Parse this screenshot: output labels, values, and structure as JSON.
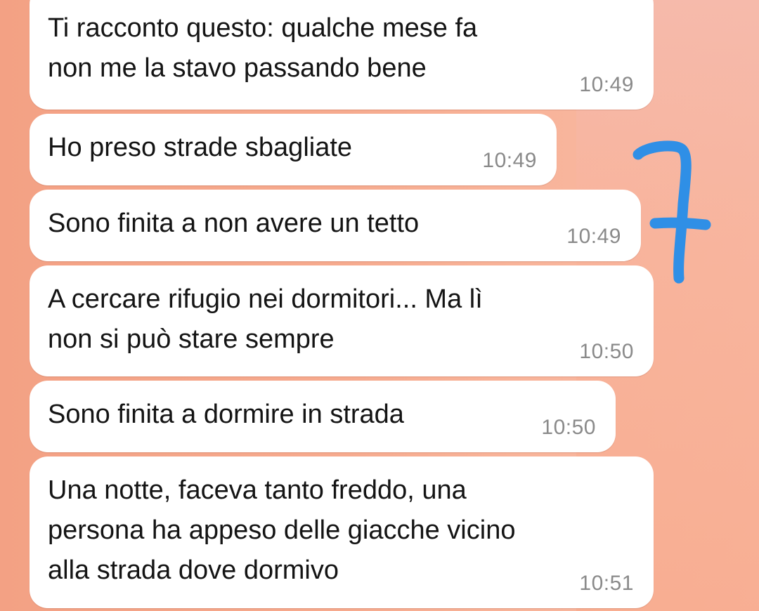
{
  "messages": [
    {
      "text": "Ti racconto questo: qualche mese fa\nnon me la stavo passando bene",
      "time": "10:49"
    },
    {
      "text": "Ho preso strade sbagliate",
      "time": "10:49"
    },
    {
      "text": "Sono finita a non avere un tetto",
      "time": "10:49"
    },
    {
      "text": "A cercare rifugio nei dormitori... Ma lì\nnon si può stare sempre",
      "time": "10:50"
    },
    {
      "text": "Sono finita a dormire in strada",
      "time": "10:50"
    },
    {
      "text": "Una notte, faceva tanto freddo, una\npersona ha appeso delle giacche vicino\nalla strada dove dormivo",
      "time": "10:51"
    }
  ],
  "annotation": {
    "text": "7",
    "color": "#2f8fe6"
  },
  "colors": {
    "bubble": "#ffffff",
    "text": "#141414",
    "timestamp": "#8a8a8a",
    "background": "#f6aa8e"
  }
}
